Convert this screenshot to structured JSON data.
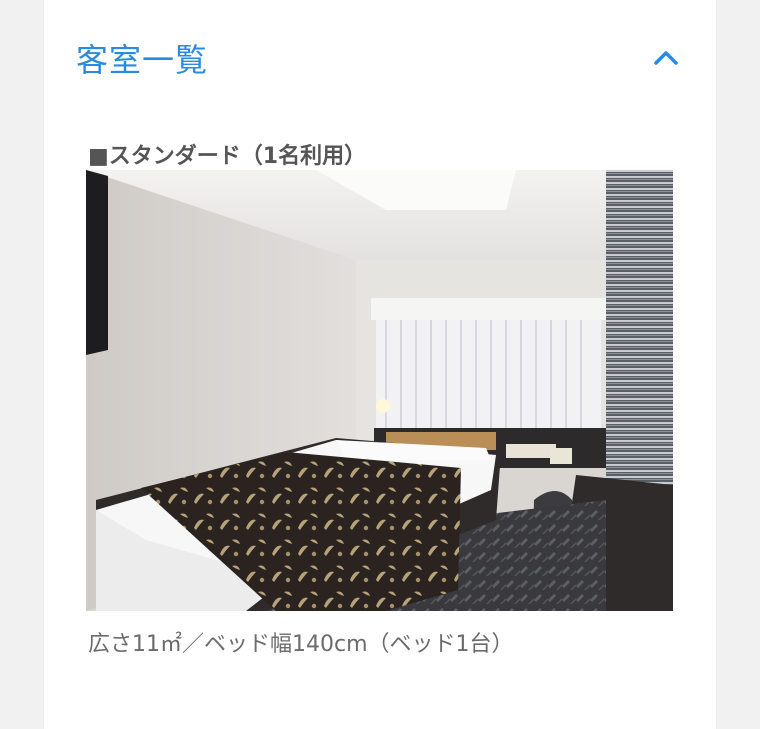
{
  "section": {
    "title": "客室一覧",
    "toggle_icon": "chevron-up-icon",
    "accent_color": "#2a8ae0"
  },
  "room": {
    "name": "■スタンダード（1名利用）",
    "caption": "広さ11㎡／ベッド幅140cm（ベッド1台）",
    "photo_subject": "hotel-room-photo"
  }
}
